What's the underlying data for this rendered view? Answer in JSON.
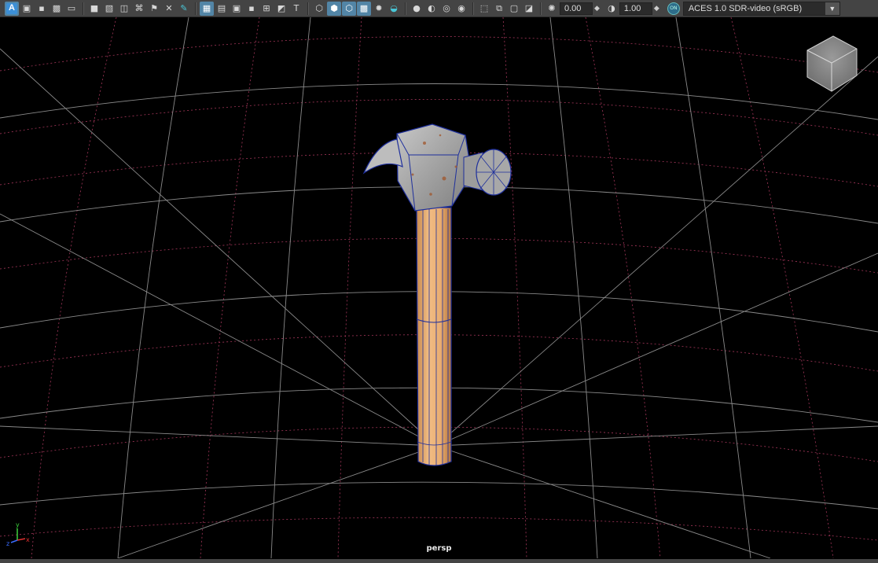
{
  "toolbar": {
    "exposure_value": "0.00",
    "gamma_value": "1.00",
    "color_space": "ACES 1.0 SDR-video (sRGB)",
    "color_mgmt_badge": "ON"
  },
  "viewport": {
    "camera_name": "persp",
    "axis_labels": {
      "x": "x",
      "y": "y",
      "z": "z"
    },
    "grid_color": "#8a8a8a",
    "grid_subdivision_color": "#c0406a",
    "wireframe_color": "#1e2f9c",
    "handle_color": "#e6a66a",
    "head_color": "#a9a9a9"
  }
}
